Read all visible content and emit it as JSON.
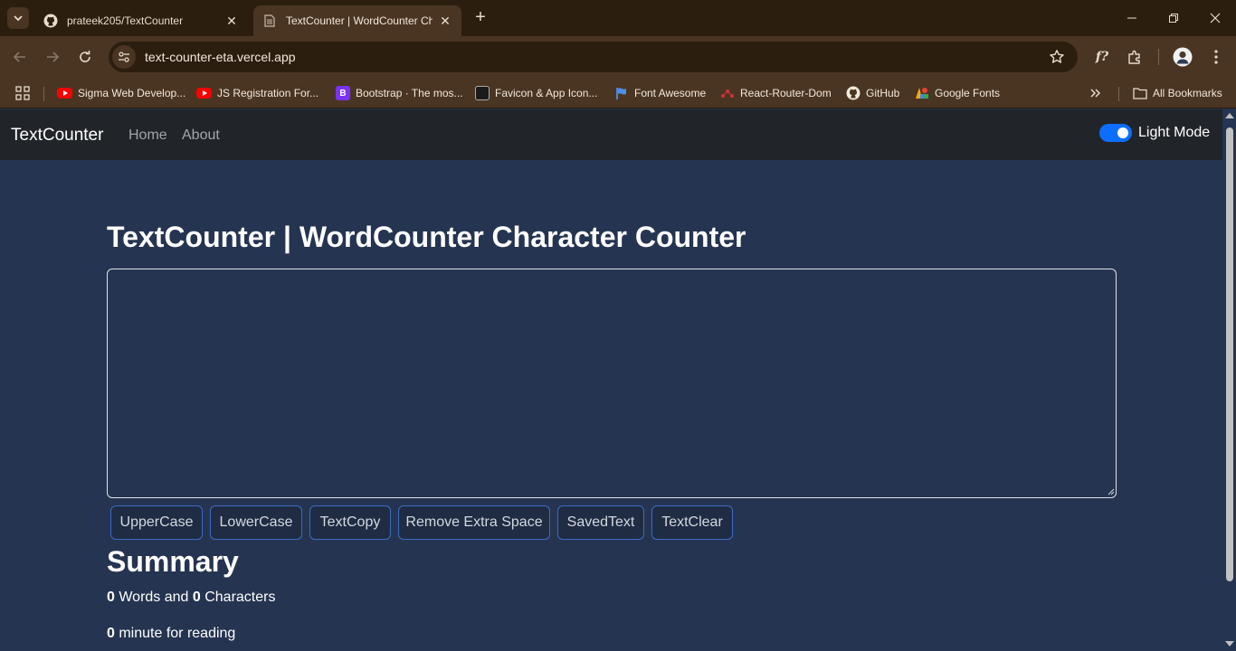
{
  "browser": {
    "tabs": [
      {
        "title": "prateek205/TextCounter",
        "favicon": "github-icon"
      },
      {
        "title": "TextCounter | WordCounter Character Counter",
        "favicon": "page-icon"
      }
    ],
    "address": "text-counter-eta.vercel.app",
    "bookmarks": [
      {
        "label": "Sigma Web Develop...",
        "icon": "youtube-icon"
      },
      {
        "label": "JS Registration For...",
        "icon": "youtube-icon"
      },
      {
        "label": "Bootstrap · The mos...",
        "icon": "bootstrap-icon",
        "glyph": "B"
      },
      {
        "label": "Favicon & App Icon...",
        "icon": "favicon-tools-icon"
      },
      {
        "label": "Font Awesome",
        "icon": "font-awesome-flag-icon"
      },
      {
        "label": "React-Router-Dom",
        "icon": "react-router-icon"
      },
      {
        "label": "GitHub",
        "icon": "github-icon"
      },
      {
        "label": "Google Fonts",
        "icon": "google-fonts-icon"
      }
    ],
    "all_bookmarks": "All Bookmarks"
  },
  "app": {
    "brand": "TextCounter",
    "nav": [
      "Home",
      "About"
    ],
    "mode_label": "Light Mode",
    "heading": "TextCounter | WordCounter Character Counter",
    "textarea_value": "",
    "buttons": [
      "UpperCase",
      "LowerCase",
      "TextCopy",
      "Remove Extra Space",
      "SavedText",
      "TextClear"
    ],
    "summary_title": "Summary",
    "word_count": "0",
    "words_and": " Words and ",
    "char_count": "0",
    "characters": " Characters",
    "read_minutes": "0",
    "reading_text": " minute for reading"
  },
  "colors": {
    "page_bg": "#253450",
    "navbar_bg": "#212529",
    "accent": "#0d6efd",
    "button_border": "#3d6bc6"
  }
}
